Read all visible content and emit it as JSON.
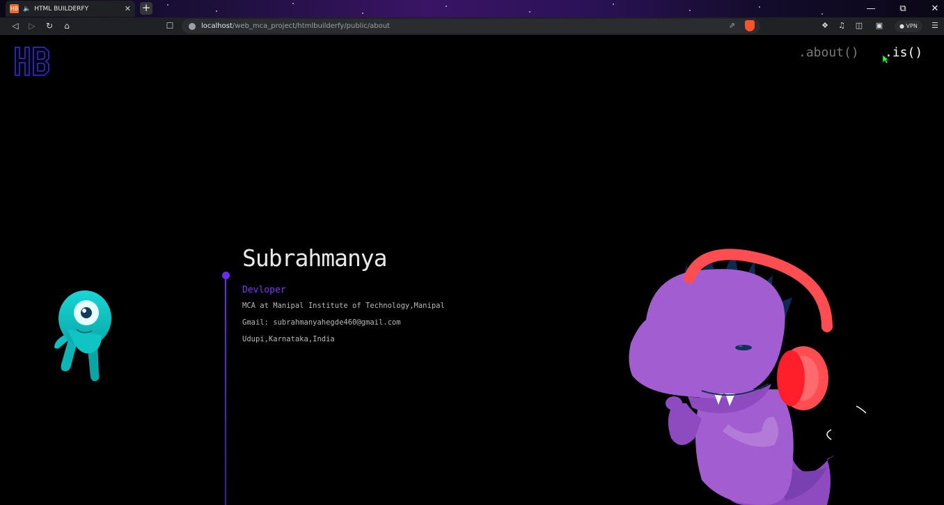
{
  "browser": {
    "tab_title": "HTML BUILDERFY",
    "tab_favicon": "HB",
    "url_host": "localhost",
    "url_path": "/web_mca_project/htmlbuilderfy/public/about",
    "vpn_label": "VPN"
  },
  "nav": {
    "about_label": ".about()",
    "is_label": ".is()"
  },
  "profile": {
    "name": "Subrahmanya",
    "role": "Devloper",
    "education": "MCA at Manipal Institute of Technology,Manipal",
    "email": "Gmail: subrahmanyahegde460@gmail.com",
    "location": "Udupi,Karnataka,India"
  },
  "colors": {
    "accent": "#6a2ee8",
    "dino_body": "#a25dd0",
    "headphones": "#ff4d52",
    "mascot": "#14c8c8"
  },
  "icons": {
    "logo": "hb-logo-icon",
    "mascot": "cyclops-mascot-icon",
    "dino": "dino-headphones-icon"
  }
}
